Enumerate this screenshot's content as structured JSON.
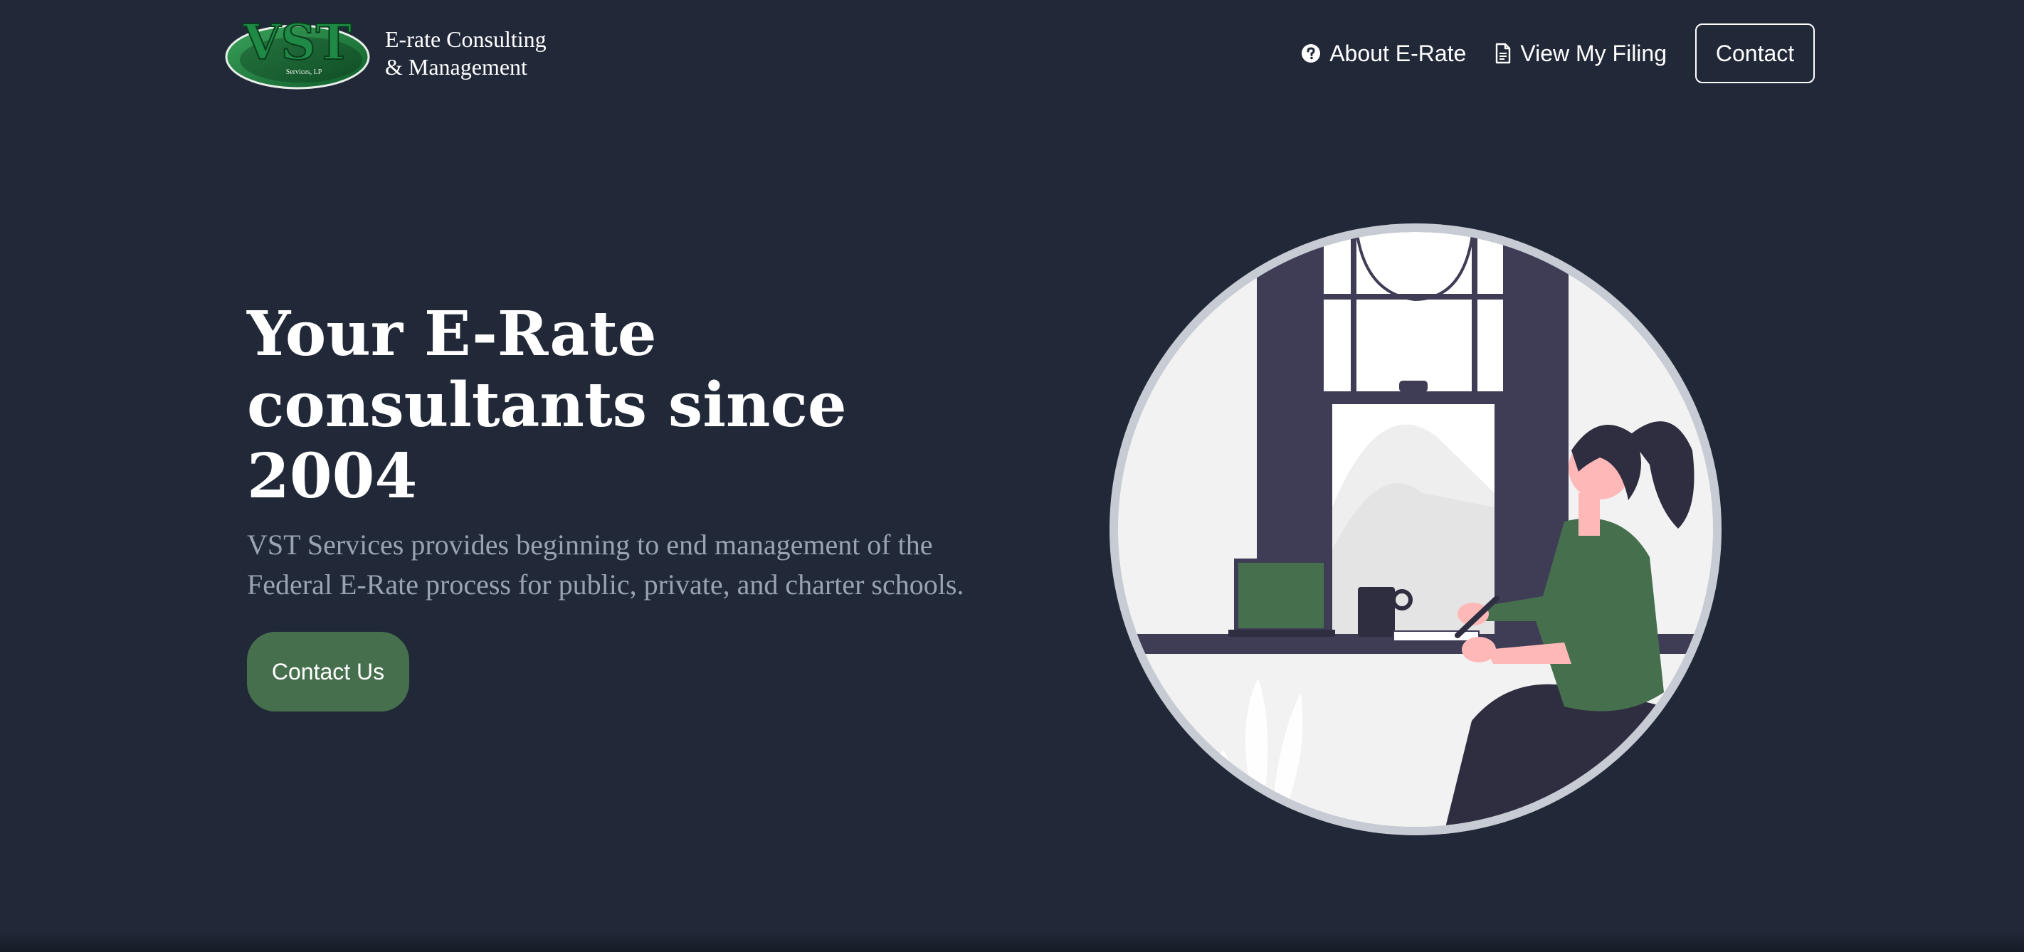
{
  "header": {
    "logo": {
      "mark_text": "VST",
      "mark_subtext": "Services, LP",
      "line1": "E-rate Consulting",
      "line2": "& Management"
    },
    "nav": [
      {
        "label": "About E-Rate",
        "icon": "question-circle-icon"
      },
      {
        "label": "View My Filing",
        "icon": "document-icon"
      }
    ],
    "contact_label": "Contact"
  },
  "hero": {
    "headline": "Your E-Rate consultants since 2004",
    "description": "VST Services provides beginning to end management of the Federal E-Rate process for public, private, and charter schools.",
    "cta_label": "Contact Us",
    "illustration": "woman-working-at-window-desk-illustration"
  },
  "colors": {
    "background": "#212938",
    "accent_green": "#46704d",
    "subtext": "#9aa3b2",
    "illustration_dark": "#3f3d56",
    "illustration_ring": "#c7cbd3"
  }
}
